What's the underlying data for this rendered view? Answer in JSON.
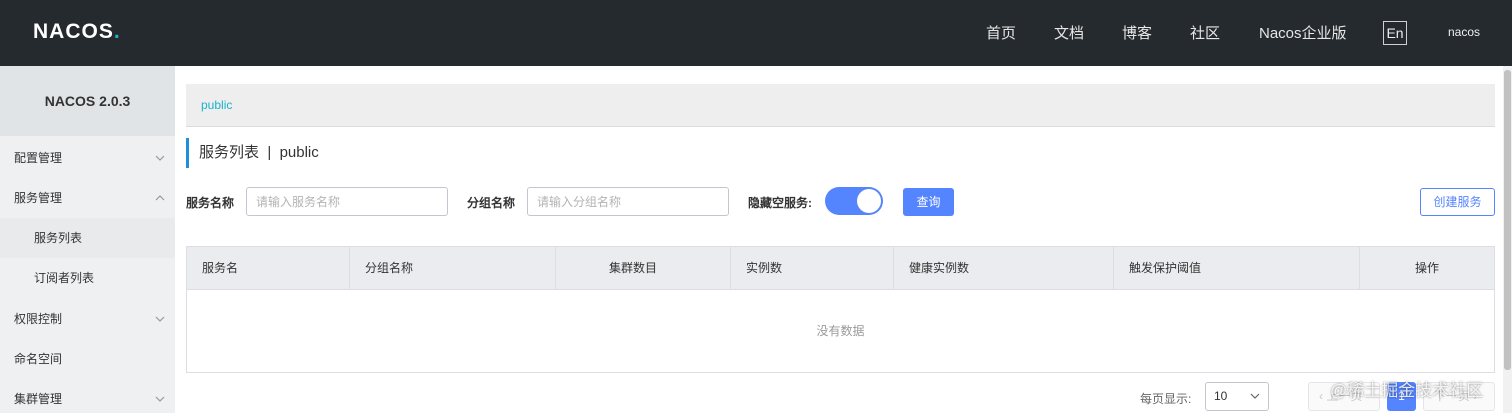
{
  "header": {
    "logo": "NACOS",
    "nav": [
      "首页",
      "文档",
      "博客",
      "社区",
      "Nacos企业版"
    ],
    "lang_button": "En",
    "user": "nacos"
  },
  "sidebar": {
    "version": "NACOS 2.0.3",
    "items": [
      {
        "label": "配置管理",
        "icon": "chevron-down-icon"
      },
      {
        "label": "服务管理",
        "icon": "chevron-up-icon"
      },
      {
        "label": "服务列表"
      },
      {
        "label": "订阅者列表"
      },
      {
        "label": "权限控制",
        "icon": "chevron-down-icon"
      },
      {
        "label": "命名空间"
      },
      {
        "label": "集群管理",
        "icon": "chevron-down-icon"
      }
    ]
  },
  "breadcrumb": "public",
  "page_title": "服务列表  |  public",
  "filters": {
    "service_name_label": "服务名称",
    "service_name_placeholder": "请输入服务名称",
    "group_name_label": "分组名称",
    "group_name_placeholder": "请输入分组名称",
    "hide_empty_label": "隐藏空服务:",
    "hide_empty_on": true,
    "query_button": "查询",
    "create_button": "创建服务"
  },
  "table": {
    "columns": [
      "服务名",
      "分组名称",
      "集群数目",
      "实例数",
      "健康实例数",
      "触发保护阈值",
      "操作"
    ],
    "rows": [],
    "empty_text": "没有数据"
  },
  "pagination": {
    "page_size_label": "每页显示:",
    "page_size": "10",
    "prev_label": "上一页",
    "current_page": "1",
    "next_label": "下一页"
  },
  "watermark": "@稀土掘金技术社区",
  "colors": {
    "header_bg": "#252a2f",
    "accent": "#5584ff",
    "link": "#1ab3c9"
  }
}
